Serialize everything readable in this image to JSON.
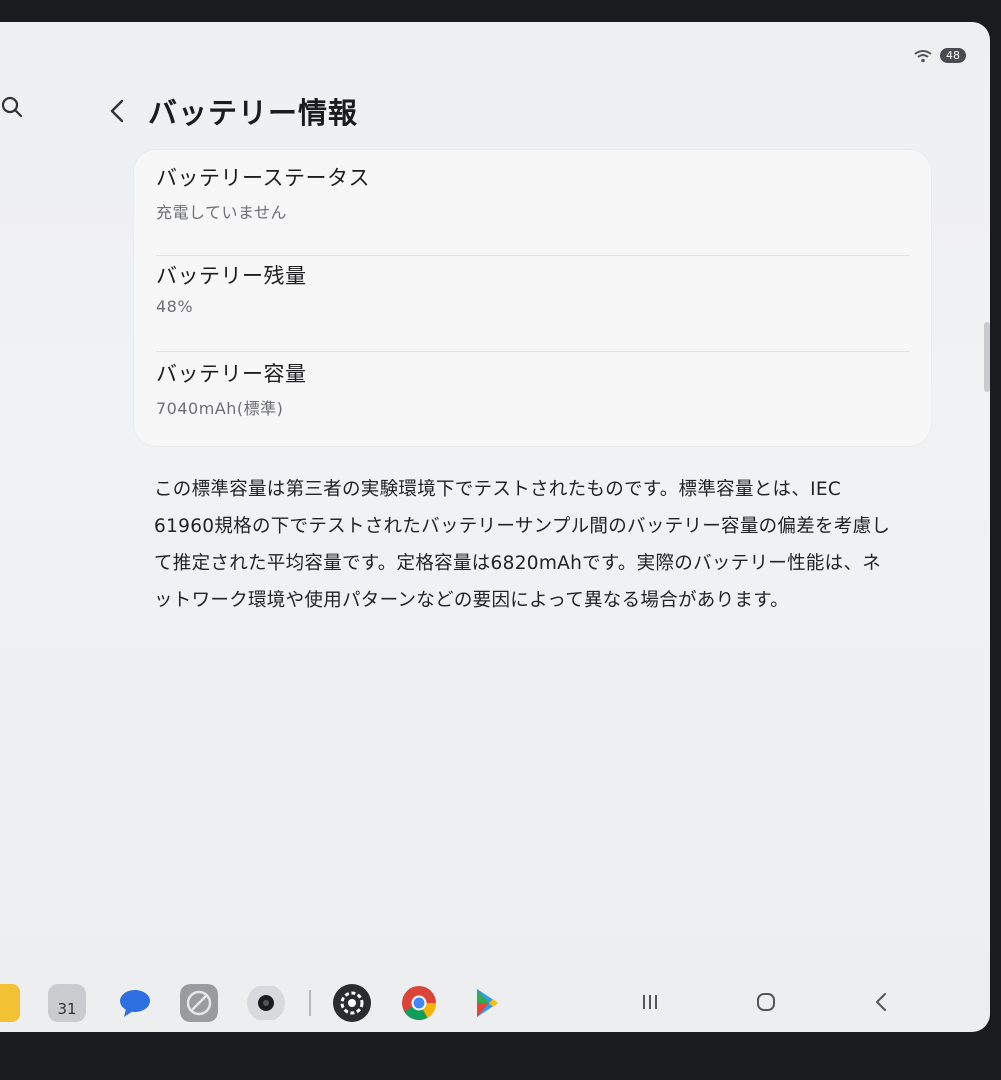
{
  "status_bar": {
    "battery_level": "48"
  },
  "header": {
    "title": "バッテリー情報"
  },
  "battery_info": [
    {
      "label": "バッテリーステータス",
      "value": "充電していません"
    },
    {
      "label": "バッテリー残量",
      "value": "48%"
    },
    {
      "label": "バッテリー容量",
      "value": "7040mAh(標準)"
    }
  ],
  "description": "この標準容量は第三者の実験環境下でテストされたものです。標準容量とは、IEC 61960規格の下でテストされたバッテリーサンプル間のバッテリー容量の偏差を考慮して推定された平均容量です。定格容量は6820mAhです。実際のバッテリー性能は、ネットワーク環境や使用パターンなどの要因によって異なる場合があります。",
  "taskbar": {
    "calendar_day": "31",
    "apps": [
      "folder-icon",
      "calendar-icon",
      "messages-icon",
      "gallery-icon",
      "camera-icon",
      "settings-icon",
      "chrome-icon",
      "play-store-icon"
    ]
  },
  "colors": {
    "accent": "#1c1c1e",
    "background": "#eff0f2",
    "card": "#f7f7f8",
    "secondary_text": "#6e6f74"
  }
}
